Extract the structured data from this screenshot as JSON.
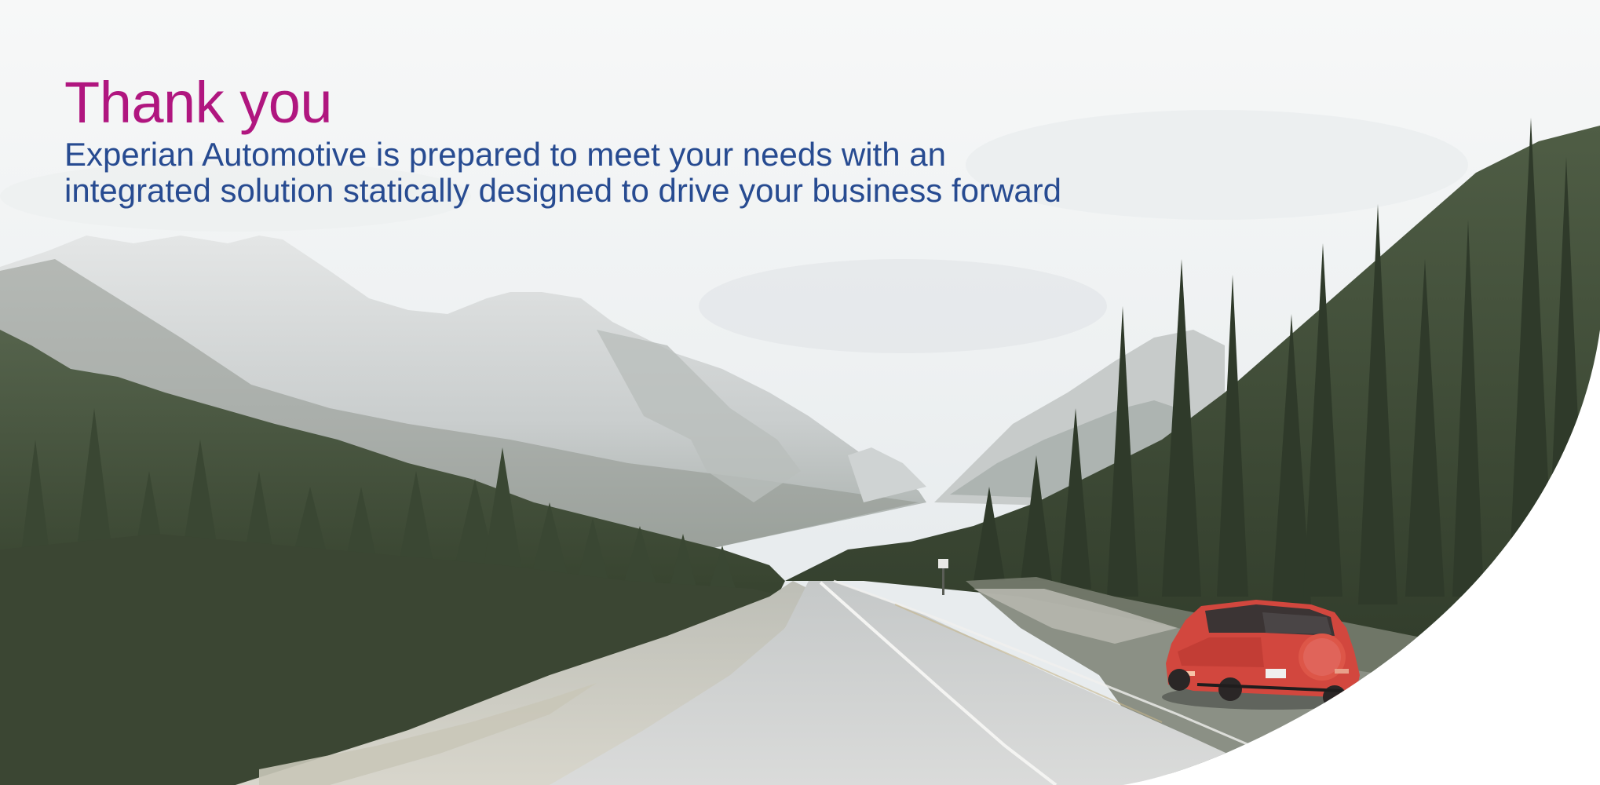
{
  "slide": {
    "title": "Thank you",
    "subtitle_line1": "Experian Automotive is prepared to meet your needs with an",
    "subtitle_line2": "integrated solution statically designed to drive your business forward"
  },
  "colors": {
    "title": "#b0167f",
    "subtitle": "#274b91",
    "sky": "#f3f5f6",
    "forest": "#3d4a36",
    "road": "#d6d7d6",
    "car": "#d2473e"
  },
  "image": {
    "description_icon": "mountain-road-photo"
  }
}
